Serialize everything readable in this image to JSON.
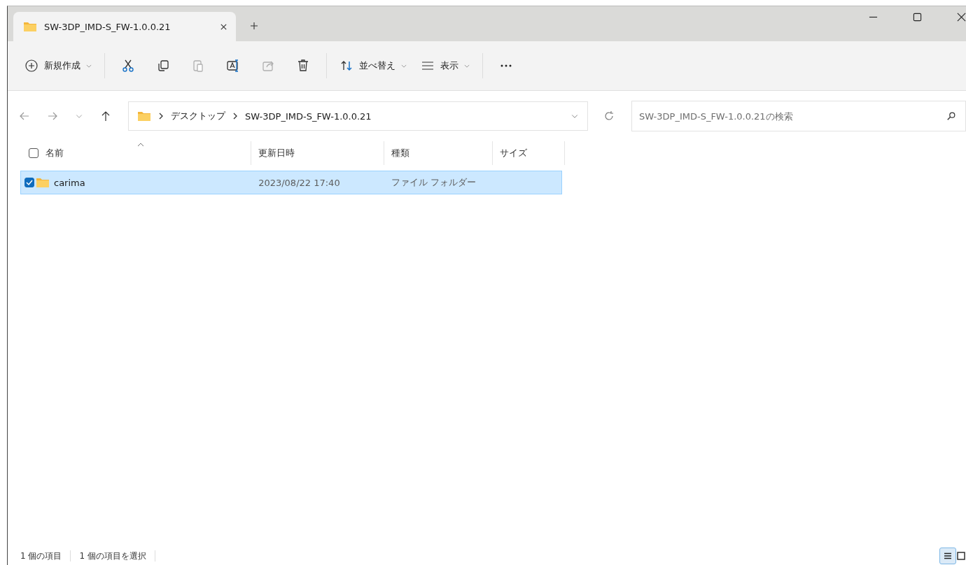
{
  "window": {
    "tab": {
      "title": "SW-3DP_IMD-S_FW-1.0.0.21",
      "selected": true
    }
  },
  "toolbar": {
    "new_button": {
      "label": "新規作成"
    },
    "icon_buttons": [
      {
        "kind": "cut",
        "disabled": false
      },
      {
        "kind": "copy",
        "disabled": false
      },
      {
        "kind": "paste",
        "disabled": true
      },
      {
        "kind": "rename",
        "disabled": false
      },
      {
        "kind": "share",
        "disabled": true
      },
      {
        "kind": "delete",
        "disabled": false
      }
    ],
    "sort_button": {
      "label": "並べ替え"
    },
    "view_button": {
      "label": "表示"
    }
  },
  "address_bar": {
    "breadcrumbs": [
      "デスクトップ",
      "SW-3DP_IMD-S_FW-1.0.0.21"
    ]
  },
  "search": {
    "placeholder": "SW-3DP_IMD-S_FW-1.0.0.21の検索"
  },
  "table": {
    "select_all_checked": false,
    "columns": [
      "名前",
      "更新日時",
      "種類",
      "サイズ"
    ],
    "rows": [
      {
        "name": "carima",
        "modified": "2023/08/22 17:40",
        "type": "ファイル フォルダー",
        "selected": true,
        "checked": true
      }
    ]
  },
  "status_bar": {
    "items": [
      "1 個の項目",
      "1 個の項目を選択"
    ],
    "view_buttons": [
      {
        "kind": "details",
        "selected": true
      },
      {
        "kind": "tiles",
        "selected": false
      }
    ]
  }
}
